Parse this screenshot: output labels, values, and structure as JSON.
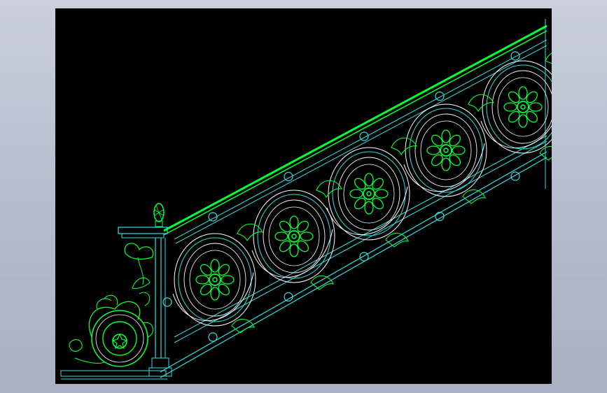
{
  "colors": {
    "background": "#000000",
    "frame": "#b8c0cc",
    "line_green": "#00ff33",
    "line_cyan": "#33e0e0",
    "line_white": "#ffffff"
  },
  "drawing": {
    "subject": "ornate-stair-railing",
    "medallion_count": 5,
    "shown_text": []
  }
}
